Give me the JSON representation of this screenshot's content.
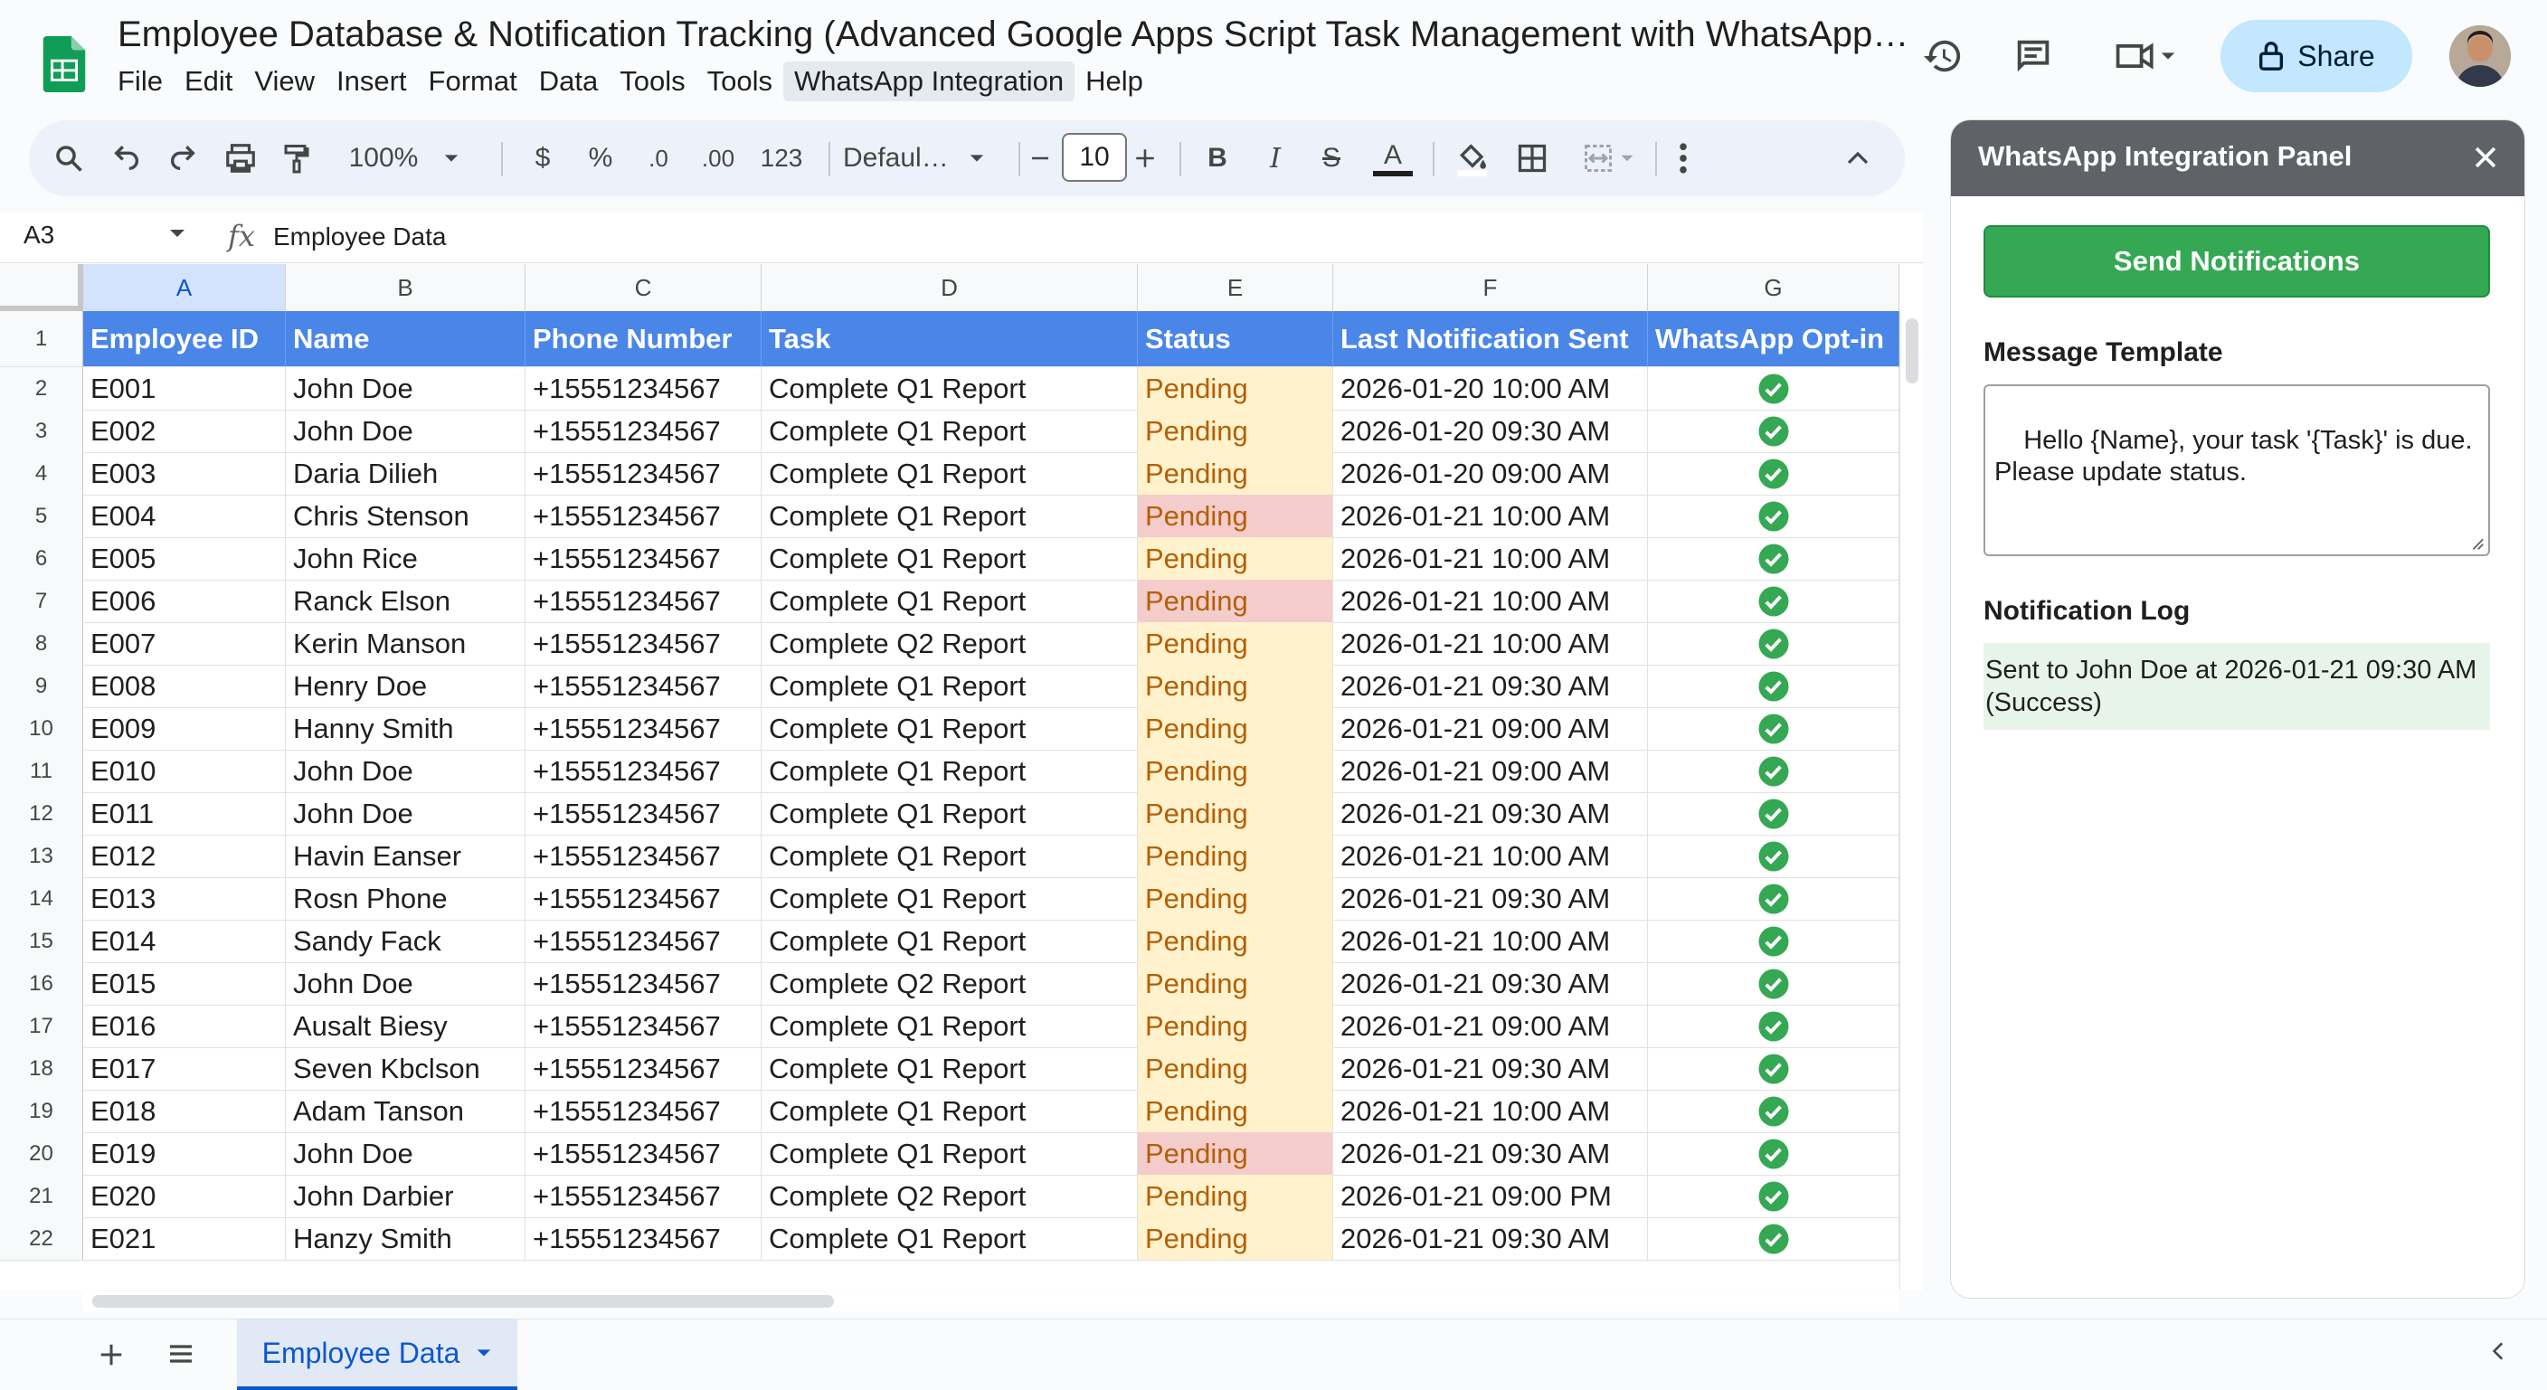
{
  "window": {
    "title": "Employee Database & Notification Tracking (Advanced Google Apps Script Task Management with WhatsApp Inte…"
  },
  "menu": [
    "File",
    "Edit",
    "View",
    "Insert",
    "Format",
    "Data",
    "Tools",
    "Tools",
    "WhatsApp Integration",
    "Help"
  ],
  "header": {
    "share_label": "Share"
  },
  "toolbar": {
    "zoom": "100%",
    "currency": "$",
    "percent": "%",
    "decrease_decimal": ".0",
    "increase_decimal": ".00",
    "number_format": "123",
    "font": "Defaul…",
    "font_size": "10",
    "bold": "B",
    "italic": "I",
    "strikethrough": "S",
    "text_color": "A"
  },
  "formula_bar": {
    "name_box": "A3",
    "content": "Employee Data"
  },
  "columns": [
    "A",
    "B",
    "C",
    "D",
    "E",
    "F",
    "G"
  ],
  "table": {
    "headers": [
      "Employee ID",
      "Name",
      "Phone Number",
      "Task",
      "Status",
      "Last Notification Sent",
      "WhatsApp Opt-in"
    ],
    "rows": [
      {
        "n": "2",
        "id": "E001",
        "name": "John Doe",
        "phone": "+15551234567",
        "task": "Complete Q1 Report",
        "status": "Pending",
        "st": "yellow",
        "last": "2026-01-20 10:00 AM"
      },
      {
        "n": "3",
        "id": "E002",
        "name": "John Doe",
        "phone": "+15551234567",
        "task": "Complete Q1 Report",
        "status": "Pending",
        "st": "yellow",
        "last": "2026-01-20 09:30 AM"
      },
      {
        "n": "4",
        "id": "E003",
        "name": "Daria Dilieh",
        "phone": "+15551234567",
        "task": "Complete Q1 Report",
        "status": "Pending",
        "st": "yellow",
        "last": "2026-01-20 09:00 AM"
      },
      {
        "n": "5",
        "id": "E004",
        "name": "Chris Stenson",
        "phone": "+15551234567",
        "task": "Complete Q1 Report",
        "status": "Pending",
        "st": "red",
        "last": "2026-01-21 10:00 AM"
      },
      {
        "n": "6",
        "id": "E005",
        "name": "John Rice",
        "phone": "+15551234567",
        "task": "Complete Q1 Report",
        "status": "Pending",
        "st": "yellow",
        "last": "2026-01-21 10:00 AM"
      },
      {
        "n": "7",
        "id": "E006",
        "name": "Ranck Elson",
        "phone": "+15551234567",
        "task": "Complete Q1 Report",
        "status": "Pending",
        "st": "red",
        "last": "2026-01-21 10:00 AM"
      },
      {
        "n": "8",
        "id": "E007",
        "name": "Kerin Manson",
        "phone": "+15551234567",
        "task": "Complete Q2 Report",
        "status": "Pending",
        "st": "yellow",
        "last": "2026-01-21 10:00 AM"
      },
      {
        "n": "9",
        "id": "E008",
        "name": "Henry Doe",
        "phone": "+15551234567",
        "task": "Complete Q1 Report",
        "status": "Pending",
        "st": "yellow",
        "last": "2026-01-21 09:30 AM"
      },
      {
        "n": "10",
        "id": "E009",
        "name": "Hanny Smith",
        "phone": "+15551234567",
        "task": "Complete Q1 Report",
        "status": "Pending",
        "st": "yellow",
        "last": "2026-01-21 09:00 AM"
      },
      {
        "n": "11",
        "id": "E010",
        "name": "John Doe",
        "phone": "+15551234567",
        "task": "Complete Q1 Report",
        "status": "Pending",
        "st": "yellow",
        "last": "2026-01-21 09:00 AM"
      },
      {
        "n": "12",
        "id": "E011",
        "name": "John Doe",
        "phone": "+15551234567",
        "task": "Complete Q1 Report",
        "status": "Pending",
        "st": "yellow",
        "last": "2026-01-21 09:30 AM"
      },
      {
        "n": "13",
        "id": "E012",
        "name": "Havin Eanser",
        "phone": "+15551234567",
        "task": "Complete Q1 Report",
        "status": "Pending",
        "st": "yellow",
        "last": "2026-01-21 10:00 AM"
      },
      {
        "n": "14",
        "id": "E013",
        "name": "Rosn Phone",
        "phone": "+15551234567",
        "task": "Complete Q1 Report",
        "status": "Pending",
        "st": "yellow",
        "last": "2026-01-21 09:30 AM"
      },
      {
        "n": "15",
        "id": "E014",
        "name": "Sandy Fack",
        "phone": "+15551234567",
        "task": "Complete Q1 Report",
        "status": "Pending",
        "st": "yellow",
        "last": "2026-01-21 10:00 AM"
      },
      {
        "n": "16",
        "id": "E015",
        "name": "John Doe",
        "phone": "+15551234567",
        "task": "Complete Q2 Report",
        "status": "Pending",
        "st": "yellow",
        "last": "2026-01-21 09:30 AM"
      },
      {
        "n": "17",
        "id": "E016",
        "name": "Ausalt Biesy",
        "phone": "+15551234567",
        "task": "Complete Q1 Report",
        "status": "Pending",
        "st": "yellow",
        "last": "2026-01-21 09:00 AM"
      },
      {
        "n": "18",
        "id": "E017",
        "name": "Seven Kbclson",
        "phone": "+15551234567",
        "task": "Complete Q1 Report",
        "status": "Pending",
        "st": "yellow",
        "last": "2026-01-21 09:30 AM"
      },
      {
        "n": "19",
        "id": "E018",
        "name": "Adam Tanson",
        "phone": "+15551234567",
        "task": "Complete Q1 Report",
        "status": "Pending",
        "st": "yellow",
        "last": "2026-01-21 10:00 AM"
      },
      {
        "n": "20",
        "id": "E019",
        "name": "John Doe",
        "phone": "+15551234567",
        "task": "Complete Q1 Report",
        "status": "Pending",
        "st": "red",
        "last": "2026-01-21 09:30 AM"
      },
      {
        "n": "21",
        "id": "E020",
        "name": "John Darbier",
        "phone": "+15551234567",
        "task": "Complete Q2 Report",
        "status": "Pending",
        "st": "yellow",
        "last": "2026-01-21 09:00 PM"
      },
      {
        "n": "22",
        "id": "E021",
        "name": "Hanzy Smith",
        "phone": "+15551234567",
        "task": "Complete Q1 Report",
        "status": "Pending",
        "st": "yellow",
        "last": "2026-01-21 09:30 AM"
      }
    ]
  },
  "sheet_tabs": [
    {
      "label": "Employee Data",
      "active": true
    }
  ],
  "side_panel": {
    "title": "WhatsApp Integration Panel",
    "send_label": "Send Notifications",
    "template_label": "Message Template",
    "template_value": "Hello {Name}, your task '{Task}' is due.\nPlease update status.",
    "log_label": "Notification Log",
    "log_entries": [
      "Sent to John Doe at 2026-01-21 09:30 AM (Success)"
    ]
  },
  "colors": {
    "header_fill": "#4a86e8",
    "status_yellow": "#fff2cc",
    "status_red": "#f4cccc",
    "optin_check": "#34a853",
    "send_button": "#34a853",
    "panel_header": "#5f6368",
    "share_button": "#c2e7ff"
  },
  "icons": {
    "logo": "sheets-logo-icon",
    "optin": "check-circle-icon"
  }
}
